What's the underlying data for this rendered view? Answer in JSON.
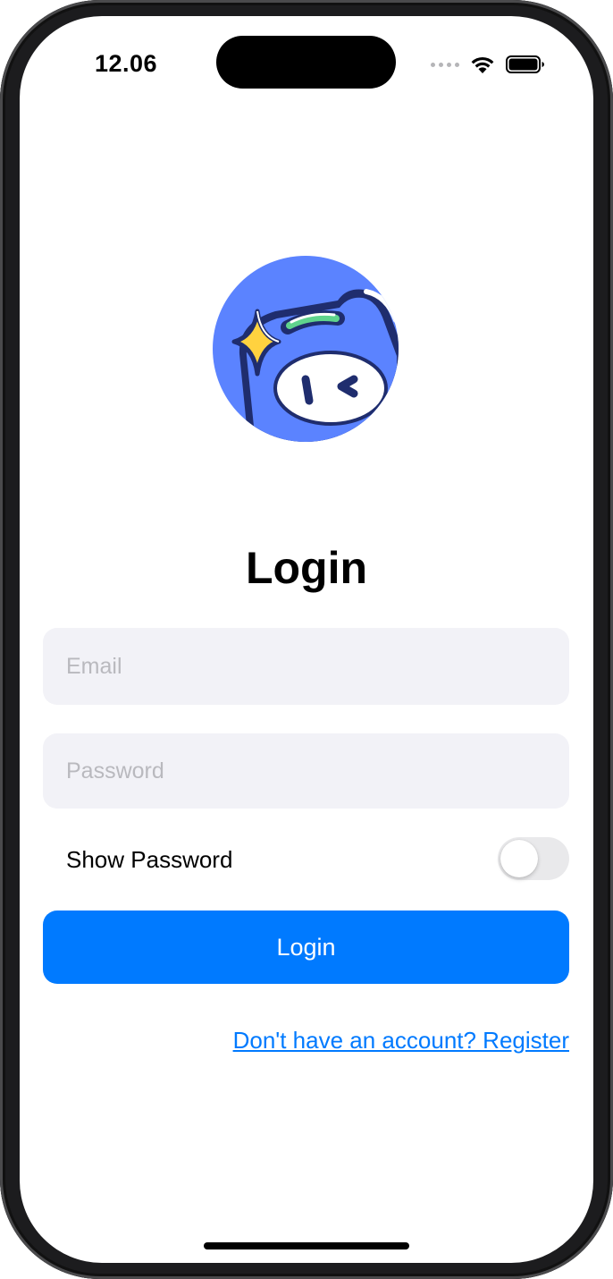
{
  "status_bar": {
    "time": "12.06"
  },
  "logo": {
    "icon": "mascot-logo-icon",
    "colors": {
      "circle": "#5b83ff",
      "outline": "#1f2d6e",
      "sparkle": "#ffd23f",
      "band": "#5fd38d",
      "face": "#ffffff"
    }
  },
  "page": {
    "title": "Login"
  },
  "form": {
    "email_placeholder": "Email",
    "email_value": "",
    "password_placeholder": "Password",
    "password_value": "",
    "show_password_label": "Show Password",
    "show_password_on": false,
    "login_button_label": "Login",
    "register_link": "Don't have an account? Register"
  },
  "colors": {
    "accent": "#007aff",
    "field_background": "#f2f2f7",
    "toggle_off": "#e9e9eb"
  }
}
